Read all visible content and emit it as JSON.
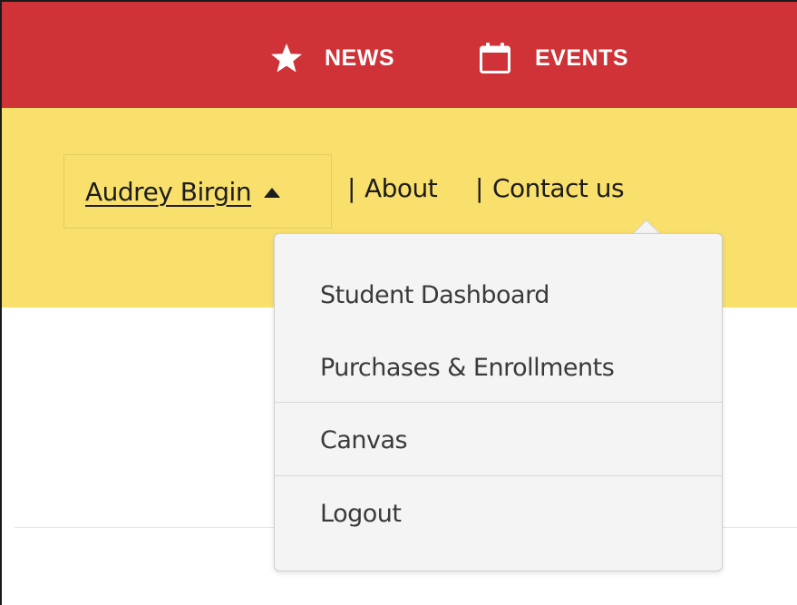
{
  "topbar": {
    "background": "#cf3237",
    "items": [
      {
        "label": "NEWS",
        "icon": "star-icon"
      },
      {
        "label": "EVENTS",
        "icon": "calendar-icon"
      }
    ]
  },
  "utility_bar": {
    "background": "#f9e06c",
    "user_name": "Audrey Birgin",
    "links": [
      {
        "separator": "|",
        "label": "About"
      },
      {
        "separator": "|",
        "label": "Contact us"
      }
    ]
  },
  "user_menu": {
    "items": [
      {
        "label": "Student Dashboard"
      },
      {
        "label": "Purchases & Enrollments"
      },
      {
        "label": "Canvas"
      },
      {
        "label": "Logout"
      }
    ]
  }
}
